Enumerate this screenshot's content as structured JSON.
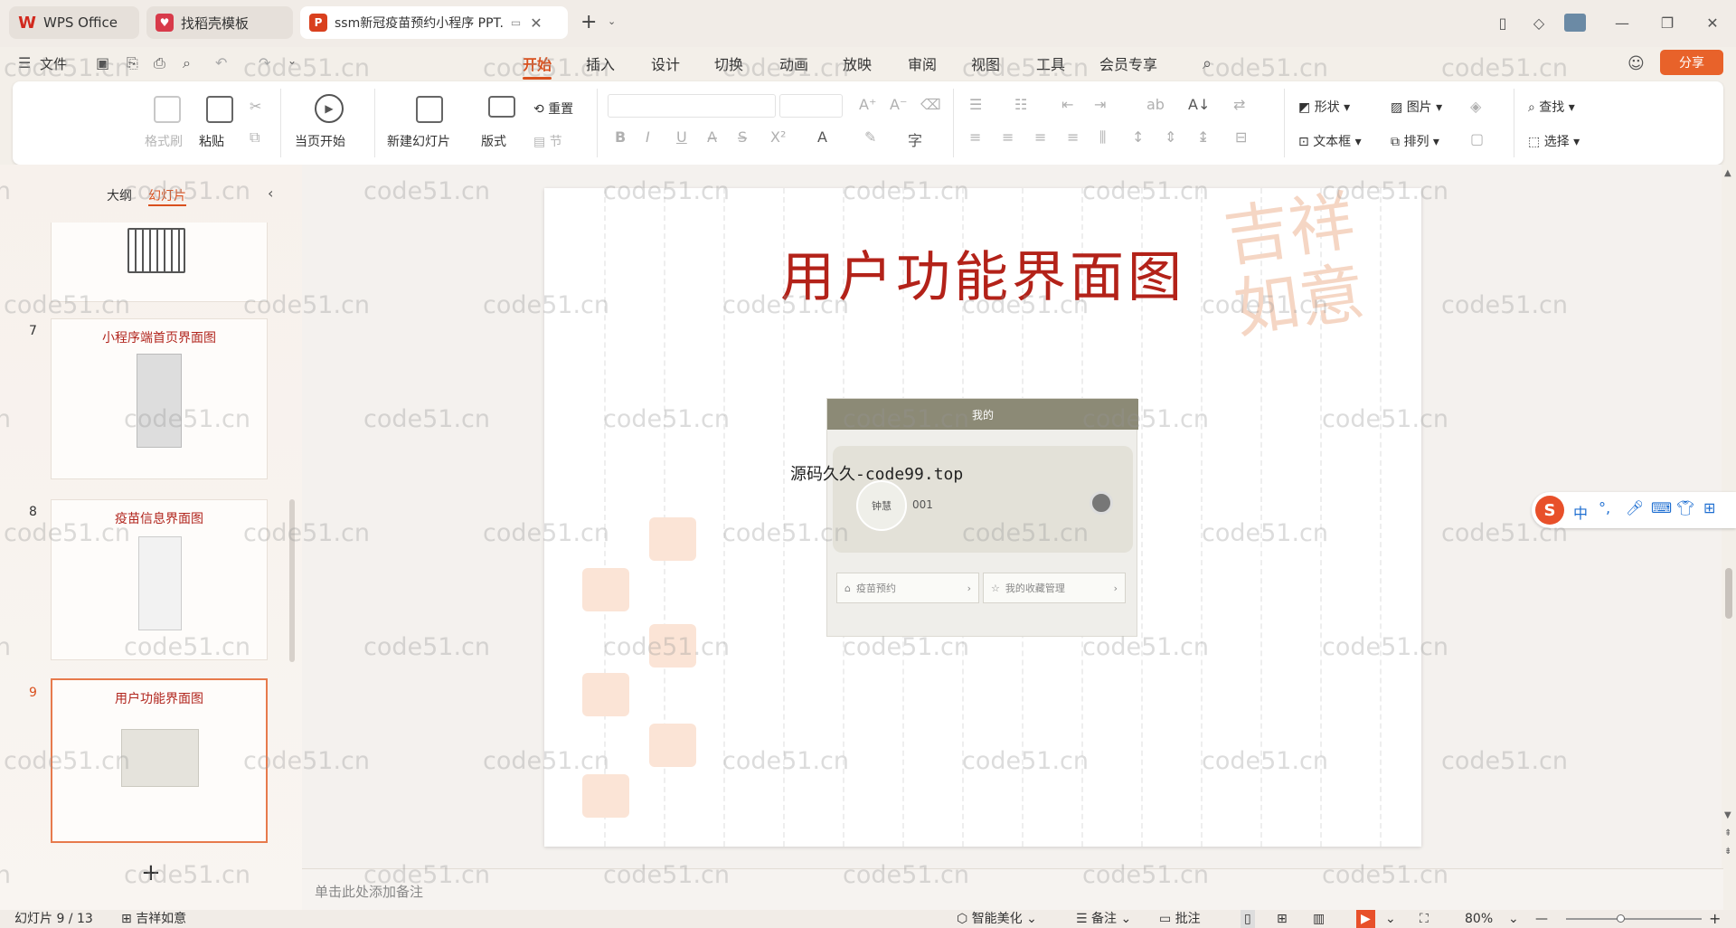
{
  "colors": {
    "accent": "#d9501e",
    "slide_title": "#b32219",
    "share_bg": "#e8622a"
  },
  "tabs": [
    {
      "label": "WPS Office",
      "icon": "wps-logo-icon"
    },
    {
      "label": "找稻壳模板",
      "icon": "docer-icon"
    },
    {
      "label": "ssm新冠疫苗预约小程序 PPT.",
      "icon": "ppt-file-icon"
    }
  ],
  "menu": {
    "file": "文件",
    "items": [
      "开始",
      "插入",
      "设计",
      "切换",
      "动画",
      "放映",
      "审阅",
      "视图",
      "工具",
      "会员专享"
    ],
    "active": "开始",
    "share": "分享"
  },
  "ribbon": {
    "format_painter": "格式刷",
    "paste": "粘贴",
    "from_current": "当页开始",
    "new_slide": "新建幻灯片",
    "layout": "版式",
    "reset": "重置",
    "section": "节",
    "shape": "形状",
    "picture": "图片",
    "textbox": "文本框",
    "arrange": "排列",
    "find": "查找",
    "select": "选择"
  },
  "left_panel": {
    "tab_outline": "大纲",
    "tab_slides": "幻灯片",
    "slides": [
      {
        "number": "7",
        "title": "小程序端首页界面图"
      },
      {
        "number": "8",
        "title": "疫苗信息界面图"
      },
      {
        "number": "9",
        "title": "用户功能界面图"
      }
    ]
  },
  "slide": {
    "title": "用户功能界面图",
    "seal_text": "吉祥如意",
    "phone": {
      "header": "我的",
      "username": "钟慧",
      "user_id": "001",
      "btn1": "疫苗预约",
      "btn2": "我的收藏管理"
    },
    "overlay_text": "源码久久-code99.top"
  },
  "notes_placeholder": "单击此处添加备注",
  "status": {
    "slide_counter": "幻灯片 9 / 13",
    "theme": "吉祥如意",
    "beautify": "智能美化",
    "notes": "备注",
    "comments": "批注",
    "zoom": "80%"
  },
  "ime": {
    "lang": "中"
  },
  "watermark": "code51.cn"
}
